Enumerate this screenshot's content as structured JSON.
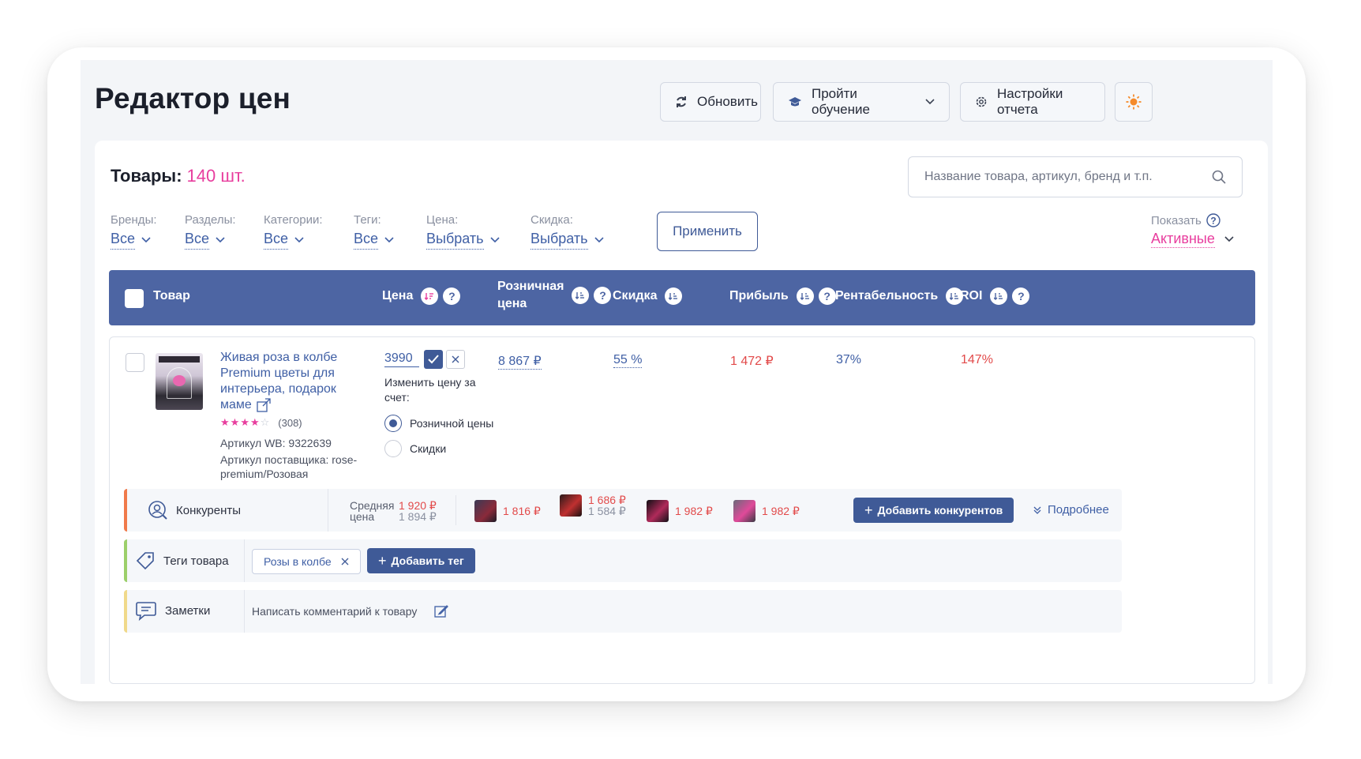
{
  "page": {
    "title": "Редактор цен"
  },
  "toolbar": {
    "refresh": "Обновить",
    "training": "Пройти обучение",
    "report_settings": "Настройки отчета",
    "theme_icon": "sun-icon"
  },
  "products": {
    "label": "Товары:",
    "count": "140 шт."
  },
  "search": {
    "placeholder": "Название товара, артикул, бренд и т.п."
  },
  "filters": [
    {
      "label": "Бренды:",
      "value": "Все"
    },
    {
      "label": "Разделы:",
      "value": "Все"
    },
    {
      "label": "Категории:",
      "value": "Все"
    },
    {
      "label": "Теги:",
      "value": "Все"
    },
    {
      "label": "Цена:",
      "value": "Выбрать"
    },
    {
      "label": "Скидка:",
      "value": "Выбрать"
    }
  ],
  "apply_label": "Применить",
  "show": {
    "label": "Показать",
    "value": "Активные"
  },
  "columns": {
    "product": "Товар",
    "price": "Цена",
    "retail_line1": "Розничная",
    "retail_line2": "цена",
    "discount": "Скидка",
    "profit": "Прибыль",
    "profitability": "Рентабельность",
    "roi": "ROI"
  },
  "row": {
    "name": "Живая роза в колбе Premium цветы для интерьера, подарок маме",
    "rating_count": "(308)",
    "article_wb": "Артикул WB: 9322639",
    "article_supplier": "Артикул поставщика: rose-premium/Розовая",
    "price_input": "3990",
    "change_label": "Изменить цену за счет:",
    "radio_retail": "Розничной цены",
    "radio_discount": "Скидки",
    "retail_price": "8 867 ₽",
    "discount": "55 %",
    "profit": "1 472 ₽",
    "profitability": "37%",
    "roi": "147%"
  },
  "competitors": {
    "label": "Конкуренты",
    "avg_line1": "Средняя",
    "avg_line2": "цена",
    "avg_price": "1 920 ₽",
    "avg_price_old": "1 894 ₽",
    "items": [
      {
        "price": "1 816 ₽",
        "old": ""
      },
      {
        "price": "1 686 ₽",
        "old": "1 584 ₽"
      },
      {
        "price": "1 982 ₽",
        "old": ""
      },
      {
        "price": "1 982 ₽",
        "old": ""
      }
    ],
    "add_label": "Добавить конкурентов",
    "more_label": "Подробнее"
  },
  "tags": {
    "label": "Теги товара",
    "chip": "Розы в колбе",
    "add_label": "Добавить тег"
  },
  "notes": {
    "label": "Заметки",
    "placeholder": "Написать комментарий к товару"
  },
  "colors": {
    "accent": "#4d65a3",
    "pink": "#e83e9e",
    "red": "#e24a4a",
    "orange_bar": "#f07a4a",
    "green_bar": "#9ccf6a",
    "yellow_bar": "#f0d98a"
  }
}
